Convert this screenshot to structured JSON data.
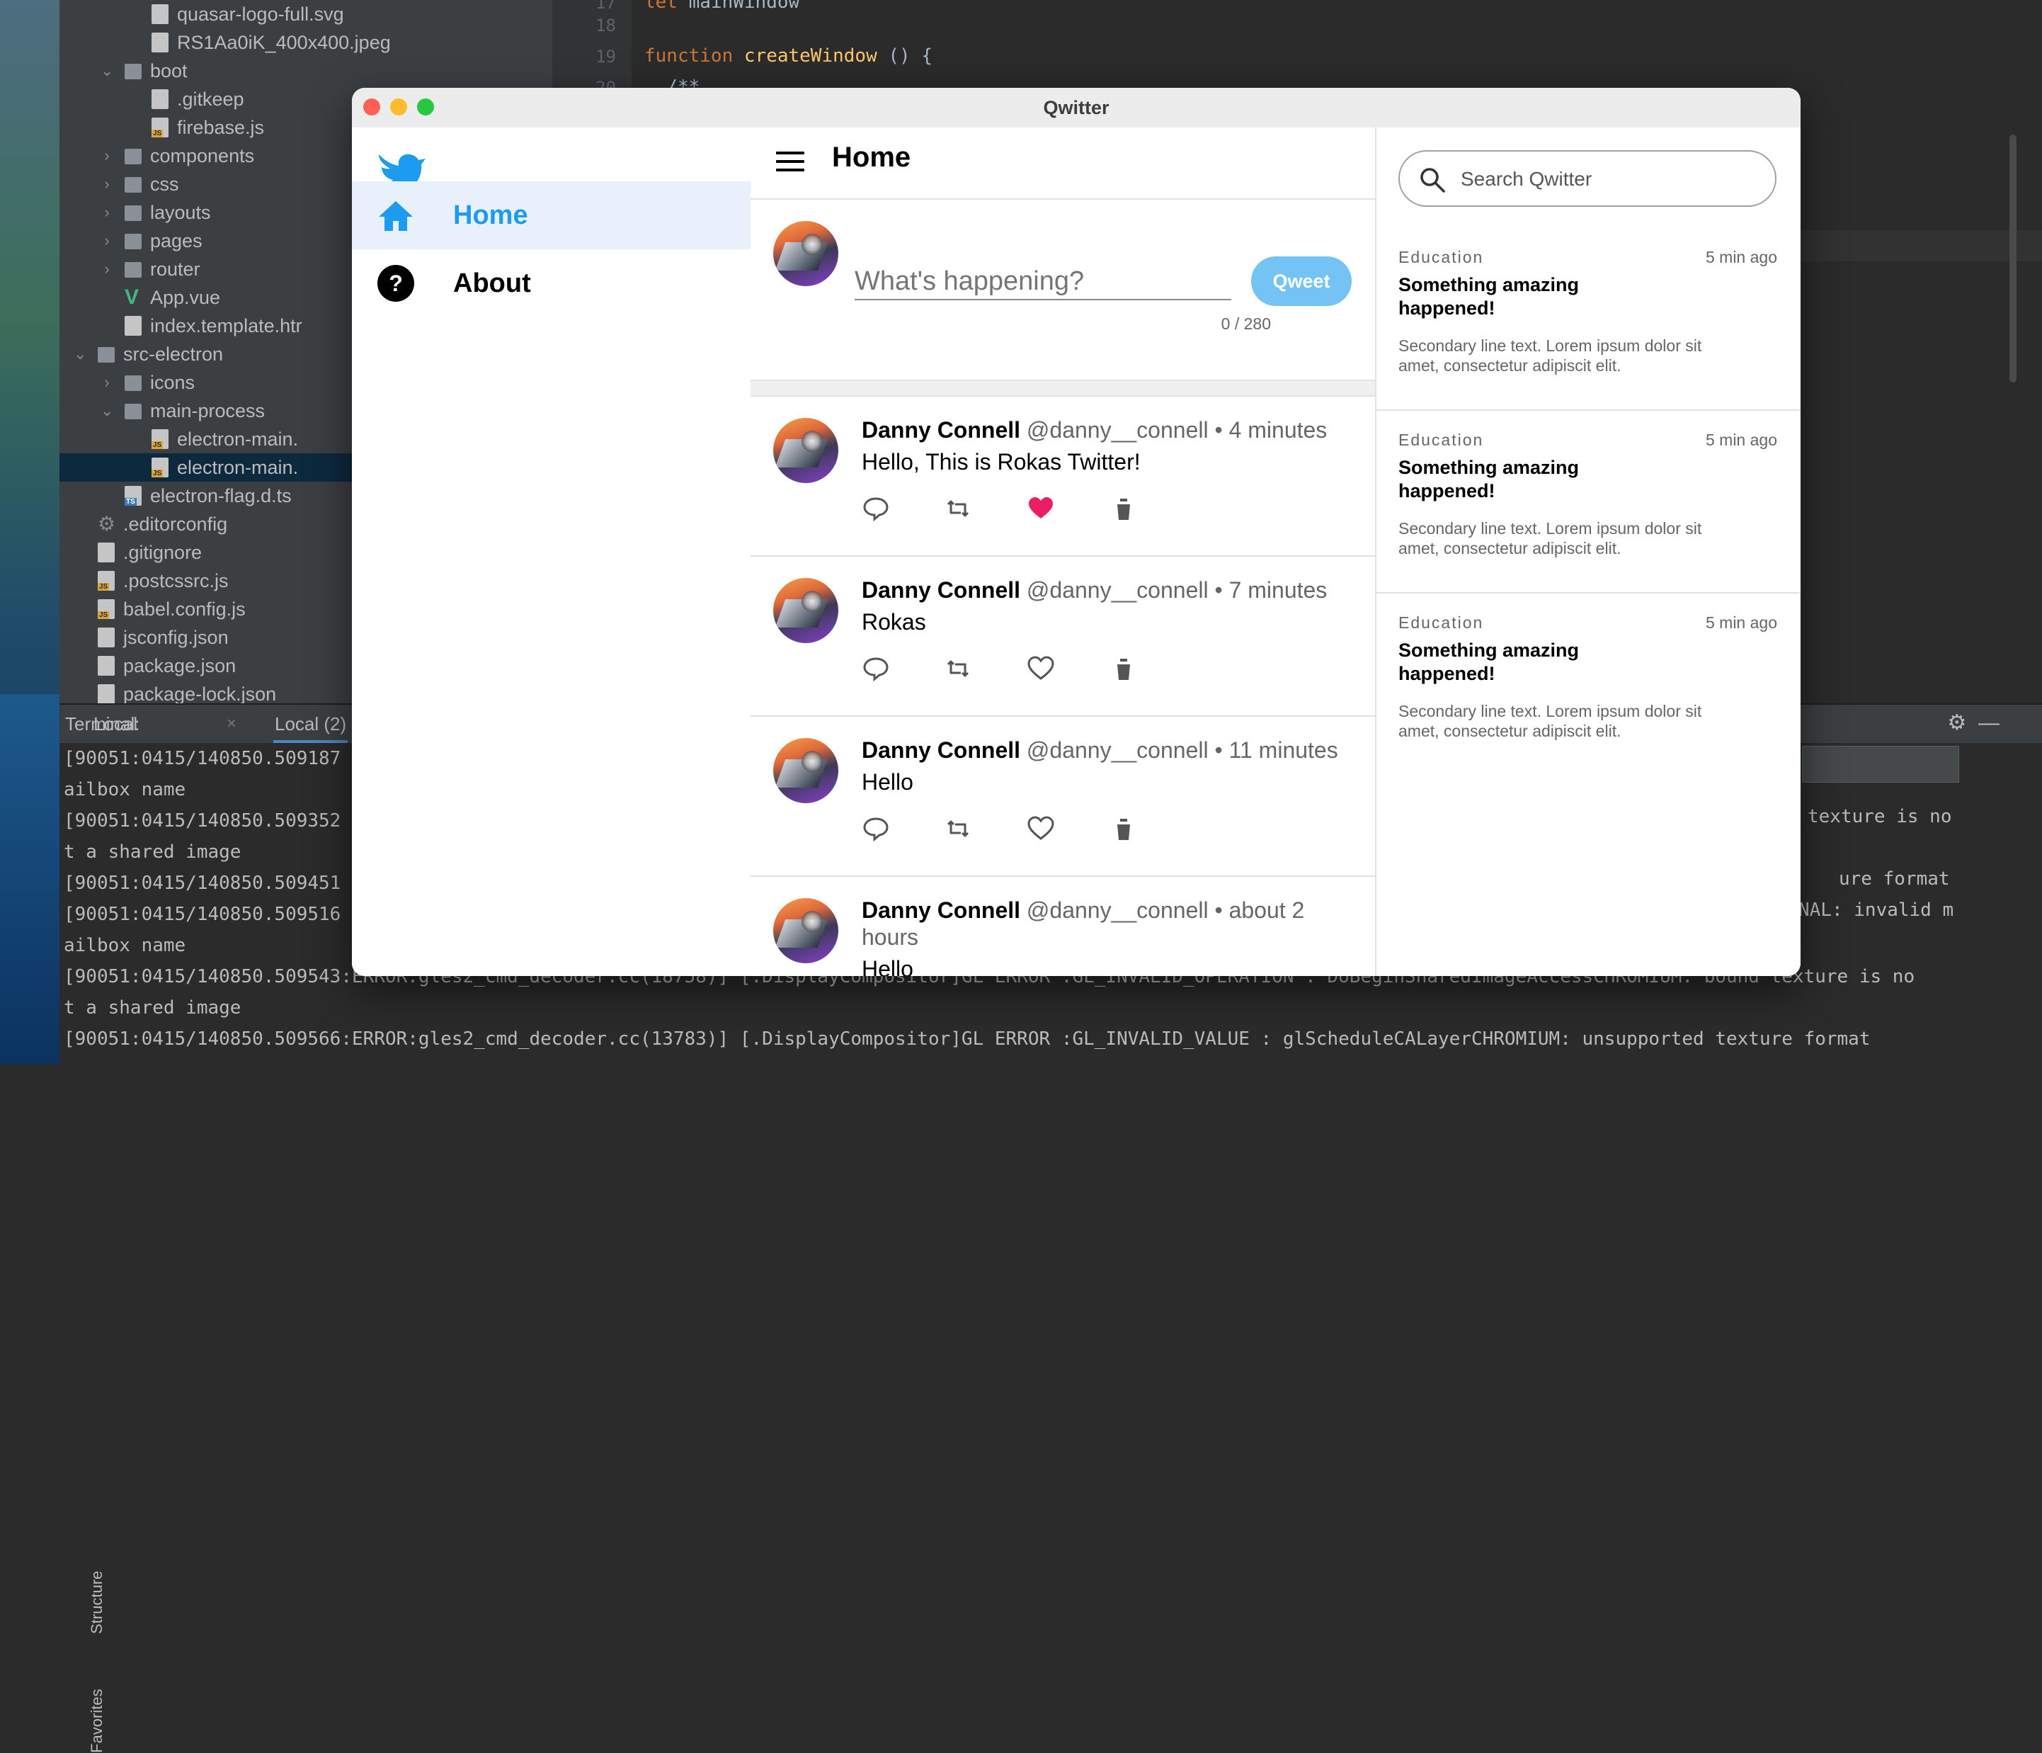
{
  "ide": {
    "tree": [
      {
        "label": "quasar-logo-full.svg",
        "indent": 2,
        "icon": "file",
        "arrow": ""
      },
      {
        "label": "RS1Aa0iK_400x400.jpeg",
        "indent": 2,
        "icon": "file",
        "arrow": ""
      },
      {
        "label": "boot",
        "indent": 1,
        "icon": "folder",
        "arrow": "open"
      },
      {
        "label": ".gitkeep",
        "indent": 2,
        "icon": "file",
        "arrow": ""
      },
      {
        "label": "firebase.js",
        "indent": 2,
        "icon": "js",
        "arrow": ""
      },
      {
        "label": "components",
        "indent": 1,
        "icon": "folder",
        "arrow": "closed"
      },
      {
        "label": "css",
        "indent": 1,
        "icon": "folder",
        "arrow": "closed"
      },
      {
        "label": "layouts",
        "indent": 1,
        "icon": "folder",
        "arrow": "closed"
      },
      {
        "label": "pages",
        "indent": 1,
        "icon": "folder",
        "arrow": "closed"
      },
      {
        "label": "router",
        "indent": 1,
        "icon": "folder",
        "arrow": "closed"
      },
      {
        "label": "App.vue",
        "indent": 1,
        "icon": "vue",
        "arrow": ""
      },
      {
        "label": "index.template.htr",
        "indent": 1,
        "icon": "file",
        "arrow": ""
      },
      {
        "label": "src-electron",
        "indent": 0,
        "icon": "folder",
        "arrow": "open"
      },
      {
        "label": "icons",
        "indent": 1,
        "icon": "folder",
        "arrow": "closed"
      },
      {
        "label": "main-process",
        "indent": 1,
        "icon": "folder",
        "arrow": "open"
      },
      {
        "label": "electron-main.",
        "indent": 2,
        "icon": "js",
        "arrow": ""
      },
      {
        "label": "electron-main.",
        "indent": 2,
        "icon": "js",
        "arrow": "",
        "selected": true
      },
      {
        "label": "electron-flag.d.ts",
        "indent": 1,
        "icon": "ts",
        "arrow": ""
      },
      {
        "label": ".editorconfig",
        "indent": 0,
        "icon": "gear",
        "arrow": ""
      },
      {
        "label": ".gitignore",
        "indent": 0,
        "icon": "file",
        "arrow": ""
      },
      {
        "label": ".postcssrc.js",
        "indent": 0,
        "icon": "js",
        "arrow": ""
      },
      {
        "label": "babel.config.js",
        "indent": 0,
        "icon": "js",
        "arrow": ""
      },
      {
        "label": "jsconfig.json",
        "indent": 0,
        "icon": "json",
        "arrow": ""
      },
      {
        "label": "package.json",
        "indent": 0,
        "icon": "json",
        "arrow": ""
      },
      {
        "label": "package-lock.json",
        "indent": 0,
        "icon": "json",
        "arrow": ""
      }
    ],
    "editor": {
      "lines": [
        {
          "num": "17",
          "code": [
            {
              "t": "let ",
              "c": "kw"
            },
            {
              "t": "mainWindow",
              "c": "plain"
            }
          ]
        },
        {
          "num": "18",
          "code": []
        },
        {
          "num": "19",
          "code": [
            {
              "t": "function ",
              "c": "kw"
            },
            {
              "t": "createWindow",
              "c": "fn"
            },
            {
              "t": " () {",
              "c": "plain"
            }
          ]
        },
        {
          "num": "20",
          "code": [
            {
              "t": "  /**",
              "c": "plain"
            }
          ]
        }
      ]
    },
    "terminal": {
      "label": "Terminal:",
      "tabs": [
        "Local",
        "Local (2)"
      ],
      "close_glyph": "×",
      "lines": [
        "[90051:0415/140850.509187",
        "ailbox name",
        "[90051:0415/140850.509352",
        "t a shared image",
        "[90051:0415/140850.509451",
        "[90051:0415/140850.509516",
        "ailbox name",
        "[90051:0415/140850.509543:ERROR:gles2_cmd_decoder.cc(18758)] [.DisplayCompositor]GL ERROR :GL_INVALID_OPERATION : DoBeginSharedImageAccessCHROMIUM: bound texture is no",
        "t a shared image",
        "[90051:0415/140850.509566:ERROR:gles2_cmd_decoder.cc(13783)] [.DisplayCompositor]GL ERROR :GL_INVALID_VALUE : glScheduleCALayerCHROMIUM: unsupported texture format"
      ],
      "right_fragments": [
        "texture is no",
        "ure format",
        "NAL: invalid m"
      ],
      "side_labels": [
        "Structure",
        "Favorites"
      ]
    }
  },
  "app": {
    "title": "Qwitter",
    "accent": "#1d9bf0",
    "nav": [
      {
        "label": "Home",
        "icon": "home-icon",
        "active": true
      },
      {
        "label": "About",
        "icon": "help-icon",
        "active": false
      }
    ],
    "header_title": "Home",
    "compose": {
      "placeholder": "What's happening?",
      "counter": "0 / 280",
      "button": "Qweet"
    },
    "tweets": [
      {
        "name": "Danny Connell",
        "handle": "@danny__connell",
        "time": "• 4 minutes",
        "text": "Hello, This is Rokas Twitter!",
        "liked": true
      },
      {
        "name": "Danny Connell",
        "handle": "@danny__connell",
        "time": "• 7 minutes",
        "text": "Rokas",
        "liked": false
      },
      {
        "name": "Danny Connell",
        "handle": "@danny__connell",
        "time": "• 11 minutes",
        "text": "Hello",
        "liked": false
      },
      {
        "name": "Danny Connell",
        "handle": "@danny__connell",
        "time": "• about 2 hours",
        "text": "Hello",
        "liked": false
      }
    ],
    "search_placeholder": "Search Qwitter",
    "news": [
      {
        "category": "Education",
        "time": "5 min ago",
        "title": "Something amazing happened!",
        "body": "Secondary line text. Lorem ipsum dolor sit amet, consectetur adipiscit elit."
      },
      {
        "category": "Education",
        "time": "5 min ago",
        "title": "Something amazing happened!",
        "body": "Secondary line text. Lorem ipsum dolor sit amet, consectetur adipiscit elit."
      },
      {
        "category": "Education",
        "time": "5 min ago",
        "title": "Something amazing happened!",
        "body": "Secondary line text. Lorem ipsum dolor sit amet, consectetur adipiscit elit."
      }
    ]
  }
}
